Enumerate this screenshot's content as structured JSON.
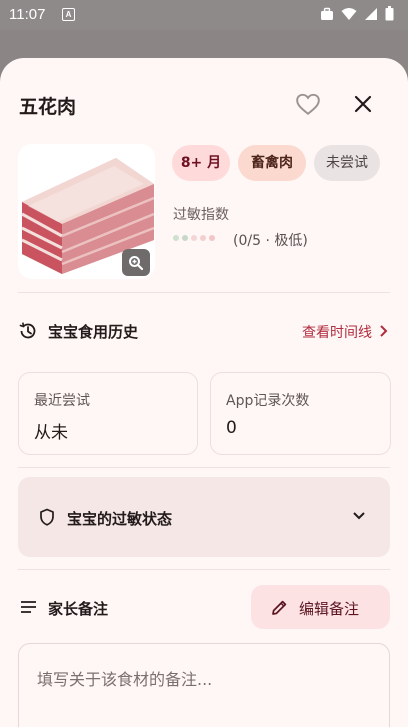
{
  "status_bar": {
    "time": "11:07",
    "notification_icon_letter": "A"
  },
  "sheet": {
    "title": "五花肉",
    "chips": {
      "age": "8+ 月",
      "category": "畜禽肉",
      "status": "未尝试"
    },
    "allergy": {
      "label": "过敏指数",
      "value": "(0/5 · 极低)",
      "dot_colors": [
        "#cfe0cf",
        "#c8d8c6",
        "#f4d6d6",
        "#f4cfd0",
        "#f0c6c8"
      ]
    },
    "history": {
      "title": "宝宝食用历史",
      "link": "查看时间线"
    },
    "cards": {
      "last_tried": {
        "label": "最近尝试",
        "value": "从未"
      },
      "app_records": {
        "label": "App记录次数",
        "value": "0"
      }
    },
    "allergy_status": {
      "label": "宝宝的过敏状态"
    },
    "notes": {
      "title": "家长备注",
      "edit_label": "编辑备注",
      "placeholder": "填写关于该食材的备注..."
    }
  },
  "colors": {
    "accent": "#b02c3f",
    "sheet_bg": "#fff7f5",
    "chip_age_bg": "#ffdadb",
    "chip_category_bg": "#fbd9cf",
    "chip_status_bg": "#e9e4e3"
  }
}
